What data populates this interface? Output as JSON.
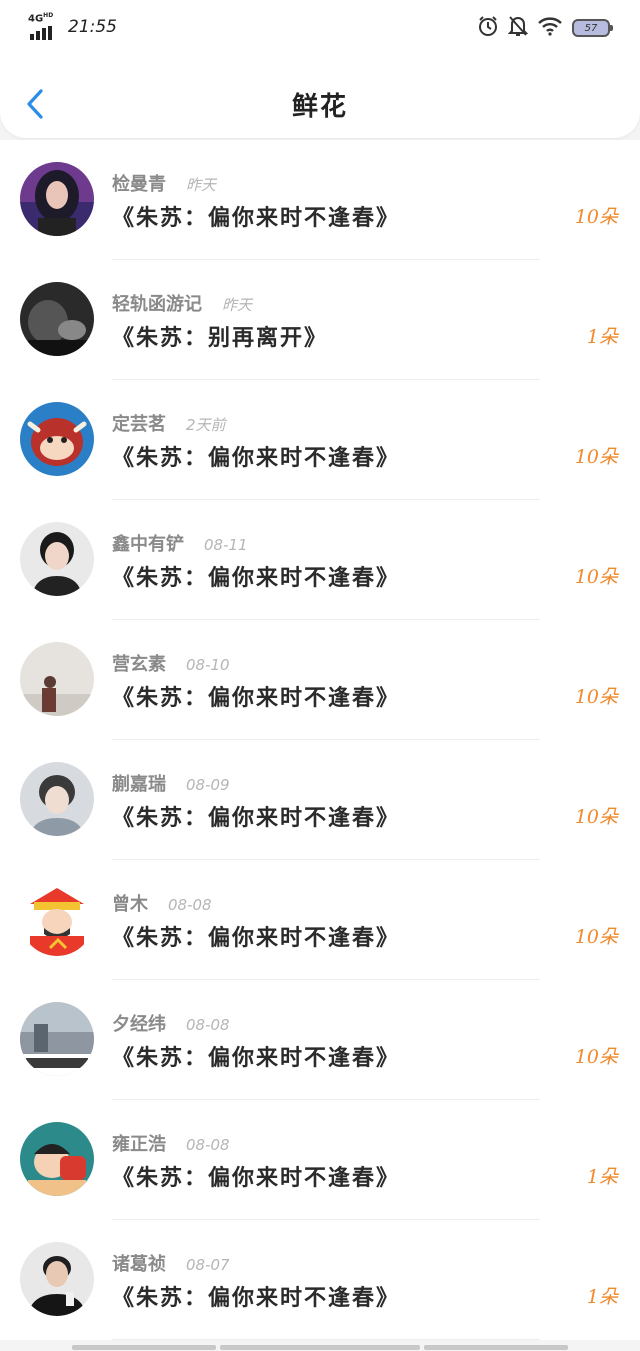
{
  "status_bar": {
    "network": "4G",
    "network_sup": "HD",
    "time": "21:55",
    "battery": "57",
    "icons": [
      "alarm-icon",
      "mute-bell-icon",
      "wifi-icon",
      "battery-icon"
    ]
  },
  "header": {
    "title": "鲜花",
    "back_icon": "chevron-left-icon",
    "accent_color": "#2b8de8"
  },
  "colors": {
    "count_color": "#f08a2c",
    "name_color": "#8a8a8a",
    "date_color": "#b5b5b5"
  },
  "records": [
    {
      "name": "检曼青",
      "date": "昨天",
      "gift": "《朱苏：偏你来时不逢春》",
      "count": "10朵",
      "avatar": "avatar-girl-dark-hair"
    },
    {
      "name": "轻轨函游记",
      "date": "昨天",
      "gift": "《朱苏：别再离开》",
      "count": "1朵",
      "avatar": "avatar-dark-photo"
    },
    {
      "name": "定芸茗",
      "date": "2天前",
      "gift": "《朱苏：偏你来时不逢春》",
      "count": "10朵",
      "avatar": "avatar-cartoon-ox"
    },
    {
      "name": "鑫中有铲",
      "date": "08-11",
      "gift": "《朱苏：偏你来时不逢春》",
      "count": "10朵",
      "avatar": "avatar-young-man"
    },
    {
      "name": "营玄素",
      "date": "08-10",
      "gift": "《朱苏：偏你来时不逢春》",
      "count": "10朵",
      "avatar": "avatar-foggy-figure"
    },
    {
      "name": "蒯嘉瑞",
      "date": "08-09",
      "gift": "《朱苏：偏你来时不逢春》",
      "count": "10朵",
      "avatar": "avatar-young-man-light"
    },
    {
      "name": "曾木",
      "date": "08-08",
      "gift": "《朱苏：偏你来时不逢春》",
      "count": "10朵",
      "avatar": "avatar-god-of-wealth"
    },
    {
      "name": "夕经纬",
      "date": "08-08",
      "gift": "《朱苏：偏你来时不逢春》",
      "count": "10朵",
      "avatar": "avatar-street-photo"
    },
    {
      "name": "雍正浩",
      "date": "08-08",
      "gift": "《朱苏：偏你来时不逢春》",
      "count": "1朵",
      "avatar": "avatar-cartoon-teal"
    },
    {
      "name": "诸葛祯",
      "date": "08-07",
      "gift": "《朱苏：偏你来时不逢春》",
      "count": "1朵",
      "avatar": "avatar-man-black-shirt"
    }
  ]
}
